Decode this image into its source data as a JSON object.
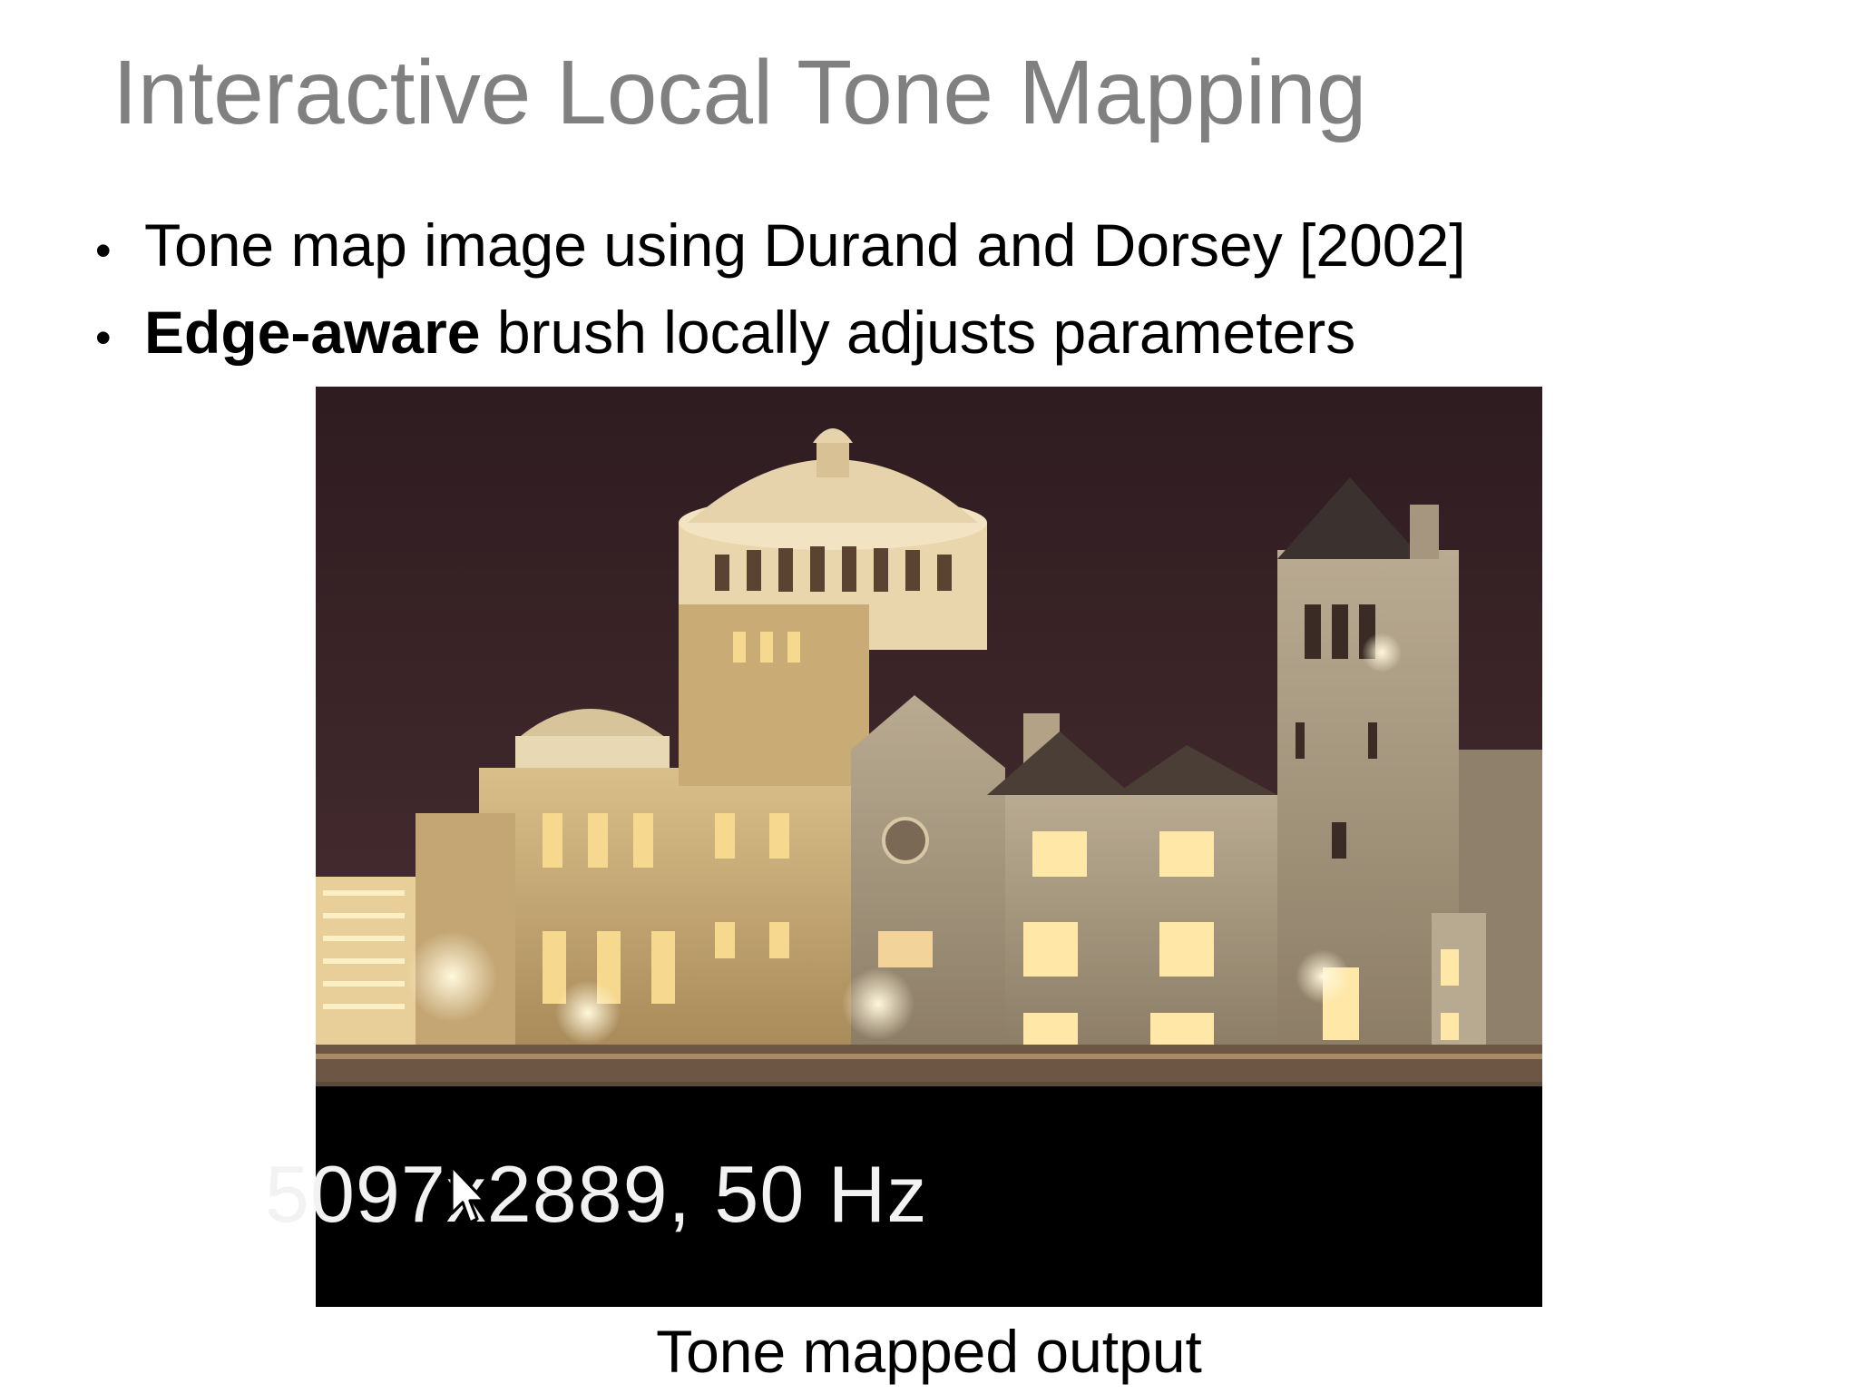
{
  "slide": {
    "title": "Interactive Local Tone Mapping",
    "bullets": [
      {
        "text": "Tone map image using Durand and Dorsey [2002]"
      },
      {
        "bold": "Edge-aware",
        "text": " brush locally adjusts parameters"
      }
    ],
    "bullet_symbol": "•"
  },
  "video": {
    "overlay_text": "5097x2889, 50 Hz",
    "cursor_icon": "mouse-pointer-icon"
  },
  "caption": "Tone mapped output",
  "colors": {
    "title": "#808080",
    "text": "#000000",
    "sky": "#3b2428",
    "stone": "#c8a872",
    "overlay_bg": "#000000",
    "overlay_text": "#f2f2f2"
  }
}
